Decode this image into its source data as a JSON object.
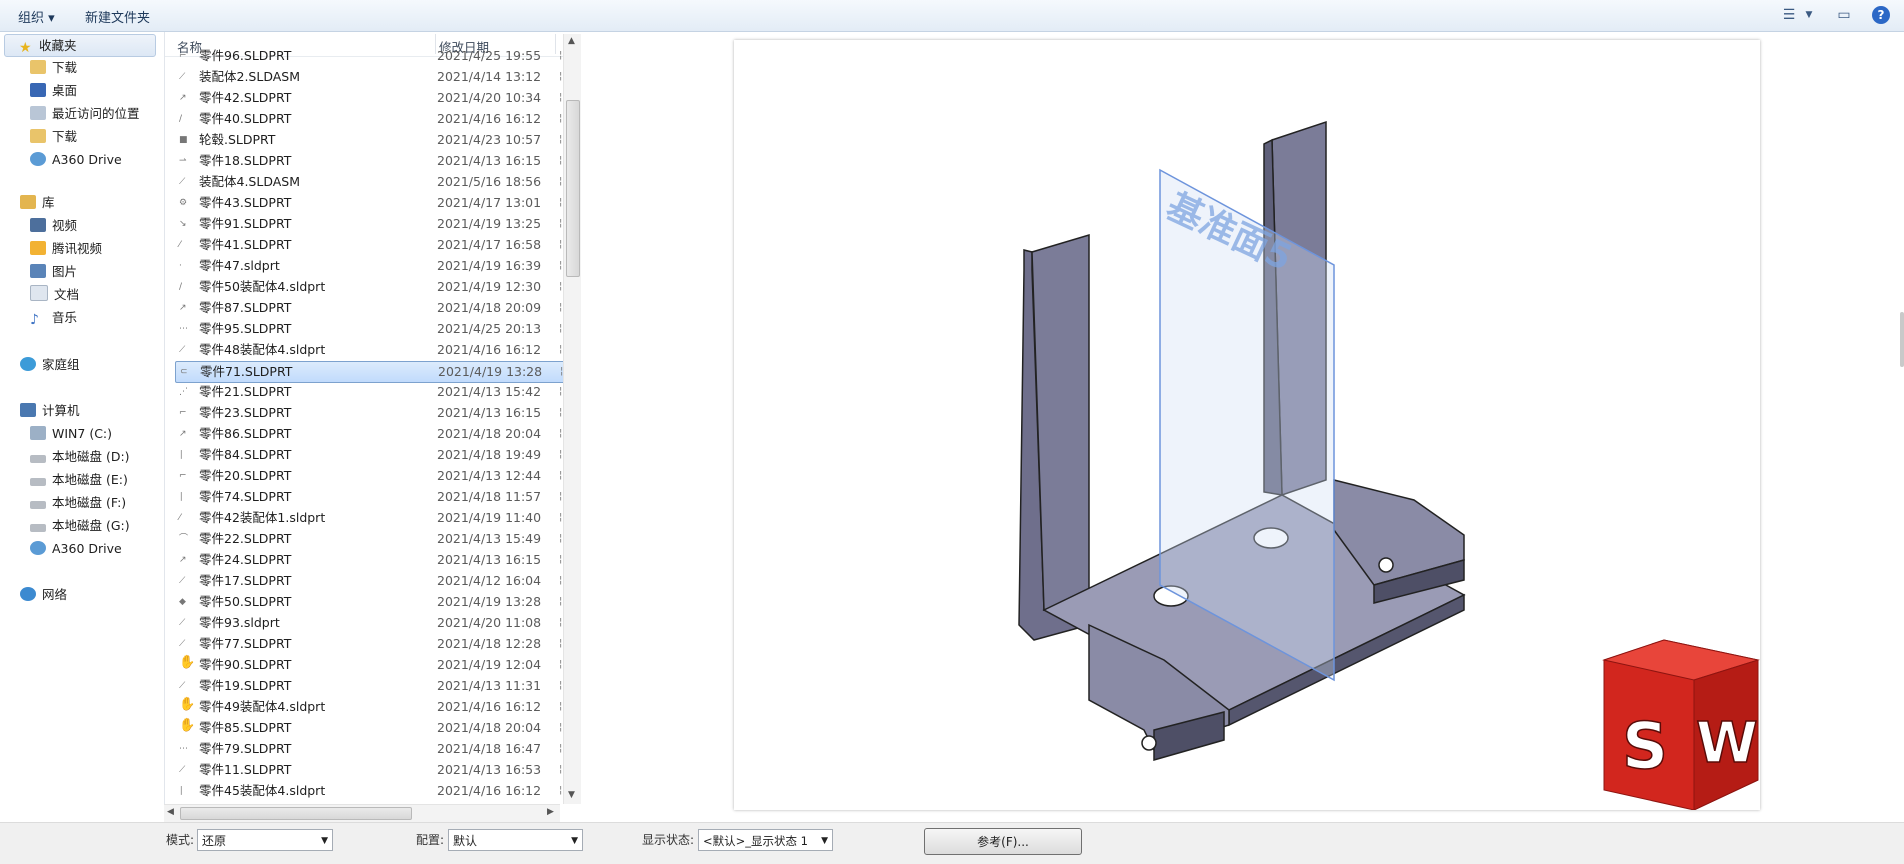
{
  "toolbar": {
    "organize_label": "组织 ▾",
    "new_folder_label": "新建文件夹",
    "view_icon": "view-options-icon",
    "help_icon": "help-icon"
  },
  "nav": {
    "favorites": {
      "label": "收藏夹",
      "items": [
        "下载",
        "桌面",
        "最近访问的位置",
        "下载",
        "A360 Drive"
      ]
    },
    "libraries": {
      "label": "库",
      "items": [
        "视频",
        "腾讯视频",
        "图片",
        "文档",
        "音乐"
      ]
    },
    "homegroup": {
      "label": "家庭组"
    },
    "computer": {
      "label": "计算机",
      "items": [
        "WIN7 (C:)",
        "本地磁盘 (D:)",
        "本地磁盘 (E:)",
        "本地磁盘 (F:)",
        "本地磁盘 (G:)",
        "A360 Drive"
      ]
    },
    "network": {
      "label": "网络"
    }
  },
  "filelist": {
    "col_name": "名称",
    "col_date": "修改日期",
    "rows": [
      {
        "name": "零件96.SLDPRT",
        "date": "2021/4/25 19:55"
      },
      {
        "name": "装配体2.SLDASM",
        "date": "2021/4/14 13:12"
      },
      {
        "name": "零件42.SLDPRT",
        "date": "2021/4/20 10:34"
      },
      {
        "name": "零件40.SLDPRT",
        "date": "2021/4/16 16:12"
      },
      {
        "name": "轮毂.SLDPRT",
        "date": "2021/4/23 10:57"
      },
      {
        "name": "零件18.SLDPRT",
        "date": "2021/4/13 16:15"
      },
      {
        "name": "装配体4.SLDASM",
        "date": "2021/5/16 18:56"
      },
      {
        "name": "零件43.SLDPRT",
        "date": "2021/4/17 13:01"
      },
      {
        "name": "零件91.SLDPRT",
        "date": "2021/4/19 13:25"
      },
      {
        "name": "零件41.SLDPRT",
        "date": "2021/4/17 16:58"
      },
      {
        "name": "零件47.sldprt",
        "date": "2021/4/19 16:39"
      },
      {
        "name": "零件50装配体4.sldprt",
        "date": "2021/4/19 12:30"
      },
      {
        "name": "零件87.SLDPRT",
        "date": "2021/4/18 20:09"
      },
      {
        "name": "零件95.SLDPRT",
        "date": "2021/4/25 20:13"
      },
      {
        "name": "零件48装配体4.sldprt",
        "date": "2021/4/16 16:12"
      },
      {
        "name": "零件71.SLDPRT",
        "date": "2021/4/19 13:28"
      },
      {
        "name": "零件21.SLDPRT",
        "date": "2021/4/13 15:42"
      },
      {
        "name": "零件23.SLDPRT",
        "date": "2021/4/13 16:15"
      },
      {
        "name": "零件86.SLDPRT",
        "date": "2021/4/18 20:04"
      },
      {
        "name": "零件84.SLDPRT",
        "date": "2021/4/18 19:49"
      },
      {
        "name": "零件20.SLDPRT",
        "date": "2021/4/13 12:44"
      },
      {
        "name": "零件74.SLDPRT",
        "date": "2021/4/18 11:57"
      },
      {
        "name": "零件42装配体1.sldprt",
        "date": "2021/4/19 11:40"
      },
      {
        "name": "零件22.SLDPRT",
        "date": "2021/4/13 15:49"
      },
      {
        "name": "零件24.SLDPRT",
        "date": "2021/4/13 16:15"
      },
      {
        "name": "零件17.SLDPRT",
        "date": "2021/4/12 16:04"
      },
      {
        "name": "零件50.SLDPRT",
        "date": "2021/4/19 13:28"
      },
      {
        "name": "零件93.sldprt",
        "date": "2021/4/20 11:08"
      },
      {
        "name": "零件77.SLDPRT",
        "date": "2021/4/18 12:28"
      },
      {
        "name": "零件90.SLDPRT",
        "date": "2021/4/19 12:04"
      },
      {
        "name": "零件19.SLDPRT",
        "date": "2021/4/13 11:31"
      },
      {
        "name": "零件49装配体4.sldprt",
        "date": "2021/4/16 16:12"
      },
      {
        "name": "零件85.SLDPRT",
        "date": "2021/4/18 20:04"
      },
      {
        "name": "零件79.SLDPRT",
        "date": "2021/4/18 16:47"
      },
      {
        "name": "零件11.SLDPRT",
        "date": "2021/4/13 16:53"
      },
      {
        "name": "零件45装配体4.sldprt",
        "date": "2021/4/16 16:12"
      }
    ],
    "selected_index": 15
  },
  "preview": {
    "plane_label": "基准面5",
    "logo_text_s": "S",
    "logo_text_w": "W"
  },
  "bottombar": {
    "mode_label": "模式:",
    "mode_value": "还原",
    "config_label": "配置:",
    "config_value": "默认",
    "display_label": "显示状态:",
    "display_value": "<默认>_显示状态 1",
    "reference_button": "参考(F)..."
  },
  "colors": {
    "selection": "#cce0f8",
    "part_body": "#7a7a94",
    "plane": "#7ea4e0",
    "logo_red": "#d2261e"
  }
}
